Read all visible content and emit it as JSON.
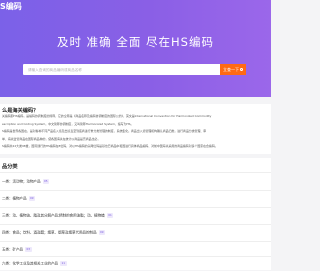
{
  "header": {
    "logo_text": "S编码",
    "slogan": "及时 准确 全面 尽在HS编码"
  },
  "search": {
    "placeholder": "请输入查询的商品编码或商品名称",
    "button_label": "立查一下"
  },
  "about": {
    "title": "么是海关编码？",
    "paragraphs": [
      "关编码即HS编码，是编码协调制度的简称，它的全称是《商品名称及编码协调制度的国际公约》，英文是International Convention for Harmonized Commodity",
      "escription and Coding System，中文简称协调制度，又叫简称Harmonized System，缩写为HS。",
      "S编码是世界各国在，是对各种不同产品名入境及出境直至到底商进行重分类管理的制度，系统集化。商品出入境管理机构确认商品归类，进行商品分类管理、审",
      "单、海关监管商品在国际商品种的，使各国海关在统计以商品是否商品也必，",
      "S编码共22大类98章，国际通行的HS编码在8位码，对以HS编码的头两位码是基也已商品中和国进行具体商品编码、对前中国海关采用的商品编码对多个国家在合编码。"
    ]
  },
  "categories": {
    "title": "品分类",
    "items": [
      {
        "text": "一类：活动物；动物产品",
        "count": "05"
      },
      {
        "text": "二类：植物产品",
        "count": "09"
      },
      {
        "text": "三类：动、植物油、脂及其分解产品;精制的食用油脂；动、植物蜡",
        "count": "01"
      },
      {
        "text": "四类：食品；饮料、酒及醋；烟草、烟草及烟草代用品的制品",
        "count": "09"
      },
      {
        "text": "五类：矿产品",
        "count": "03"
      },
      {
        "text": "六类：化学工业及其相关工业的产品",
        "count": "11"
      }
    ]
  },
  "colors": {
    "hero_gradient_start": "#7b61e8",
    "hero_gradient_end": "#9b67ea",
    "accent_orange": "#ff6a13",
    "badge_bg": "#ede8fb",
    "badge_text": "#7a5ce0"
  },
  "icons": {
    "search_button_icon": "magnifier-icon"
  }
}
